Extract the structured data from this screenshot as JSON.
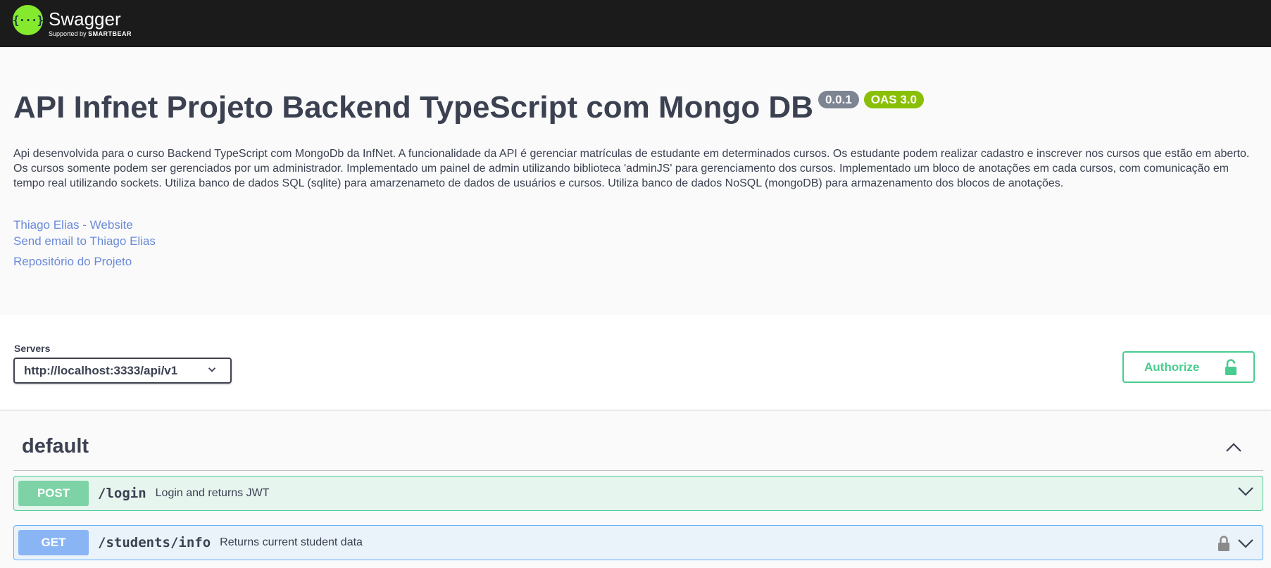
{
  "topbar": {
    "logo_mark": "{···}",
    "brand": "Swagger",
    "supported_prefix": "Supported by",
    "supported_brand": "SMARTBEAR"
  },
  "info": {
    "title": "API Infnet Projeto Backend TypeScript com Mongo DB",
    "version": "0.0.1",
    "oas": "OAS 3.0",
    "description": "Api desenvolvida para o curso Backend TypeScript com MongoDb da InfNet. A funcionalidade da API é gerenciar matrículas de estudante em determinados cursos. Os estudante podem realizar cadastro e inscrever nos cursos que estão em aberto. Os cursos somente podem ser gerenciados por um administrador. Implementado um painel de admin utilizando biblioteca 'adminJS' para gerenciamento dos cursos. Implementado um bloco de anotações em cada cursos, com comunicação em tempo real utilizando sockets. Utiliza banco de dados SQL (sqlite) para amarzenameto de dados de usuários e cursos. Utiliza banco de dados NoSQL (mongoDB) para armazenamento dos blocos de anotações.",
    "links": {
      "website": "Thiago Elias - Website",
      "email": "Send email to Thiago Elias",
      "repo": "Repositório do Projeto"
    }
  },
  "servers": {
    "label": "Servers",
    "selected": "http://localhost:3333/api/v1"
  },
  "authorize": {
    "label": "Authorize",
    "icon": "unlock-icon"
  },
  "section": {
    "title": "default",
    "expanded": true
  },
  "operations": [
    {
      "method": "POST",
      "path": "/login",
      "summary": "Login and returns JWT",
      "locked": false,
      "color": "#49cc90"
    },
    {
      "method": "GET",
      "path": "/students/info",
      "summary": "Returns current student data",
      "locked": true,
      "color": "#61affe"
    }
  ],
  "colors": {
    "topbar": "#1b1b1b",
    "brand_green": "#85ea2d",
    "link": "#6a8ad9",
    "authorize": "#49cc90",
    "version_badge": "#7d8492",
    "oas_badge": "#89bf04"
  }
}
